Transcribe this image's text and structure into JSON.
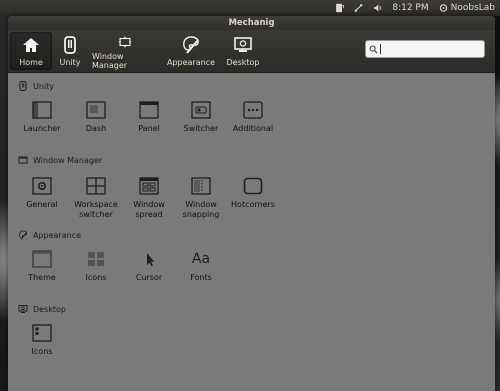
{
  "top_panel": {
    "time": "8:12 PM",
    "user": "NoobsLab"
  },
  "window": {
    "title": "Mechanig"
  },
  "toolbar": {
    "buttons": [
      {
        "label": "Home"
      },
      {
        "label": "Unity"
      },
      {
        "label": "Window Manager"
      },
      {
        "label": "Appearance"
      },
      {
        "label": "Desktop"
      }
    ],
    "search": {
      "value": "",
      "placeholder": ""
    }
  },
  "sections": {
    "unity": {
      "title": "Unity",
      "items": [
        "Launcher",
        "Dash",
        "Panel",
        "Switcher",
        "Additional"
      ]
    },
    "window_manager": {
      "title": "Window Manager",
      "items": [
        {
          "line1": "General",
          "line2": ""
        },
        {
          "line1": "Workspace",
          "line2": "switcher"
        },
        {
          "line1": "Window",
          "line2": "spread"
        },
        {
          "line1": "Window",
          "line2": "snapping"
        },
        {
          "line1": "Hotcorners",
          "line2": ""
        }
      ]
    },
    "appearance": {
      "title": "Appearance",
      "items": [
        "Theme",
        "Icons",
        "Cursor",
        "Fonts"
      ],
      "fonts_glyph": "Aa"
    },
    "desktop": {
      "title": "Desktop",
      "items": [
        "Icons"
      ]
    }
  },
  "colors": {
    "content_bg": "#7a7a7a",
    "toolbar_bg": "#2f2e2b",
    "icon_stroke": "#1e1e1e"
  }
}
